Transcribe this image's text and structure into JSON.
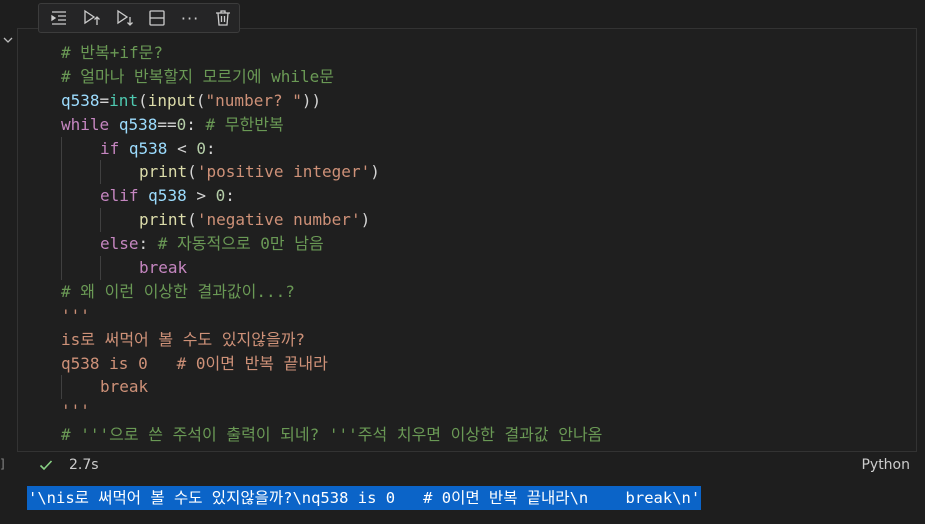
{
  "toolbar": {
    "buttons": [
      {
        "name": "run-by-line-icon"
      },
      {
        "name": "execute-above-icon"
      },
      {
        "name": "execute-below-icon"
      },
      {
        "name": "split-cell-icon"
      },
      {
        "name": "more-icon",
        "glyph": "···"
      },
      {
        "name": "delete-icon"
      }
    ]
  },
  "code": {
    "l1": "# 반복+if문?",
    "l2": "# 얼마나 반복할지 모르기에 while문",
    "l3": {
      "v": "q538",
      "eq": "=",
      "f1": "int",
      "p1": "(",
      "f2": "input",
      "p2": "(",
      "s": "\"number? \"",
      "p3": "))"
    },
    "l4": {
      "kw": "while",
      "sp": " ",
      "v": "q538",
      "op": "==",
      "n": "0",
      "colon": ":",
      "cm": " # 무한반복"
    },
    "l5": {
      "kw": "if",
      "sp": " ",
      "v": "q538",
      "op": " < ",
      "n": "0",
      "colon": ":"
    },
    "l6": {
      "f": "print",
      "p1": "(",
      "s": "'positive integer'",
      "p2": ")"
    },
    "l7": {
      "kw": "elif",
      "sp": " ",
      "v": "q538",
      "op": " > ",
      "n": "0",
      "colon": ":"
    },
    "l8": {
      "f": "print",
      "p1": "(",
      "s": "'negative number'",
      "p2": ")"
    },
    "l9": {
      "kw": "else",
      "colon": ":",
      "cm": " # 자동적으로 0만 남음"
    },
    "l10": "break",
    "l11": "# 왜 이런 이상한 결과값이...?",
    "l12": "'''",
    "l13": "is로 써먹어 볼 수도 있지않을까?",
    "l14": "q538 is 0   # 0이면 반복 끝내라",
    "l15": "break",
    "l16": "'''",
    "l17": "# '''으로 쓴 주석이 출력이 되네? '''주석 치우면 이상한 결과값 안나옴"
  },
  "status": {
    "time": "2.7s",
    "language": "Python"
  },
  "edge_label": "]",
  "output": "'\\nis로 써먹어 볼 수도 있지않을까?\\nq538 is 0   # 0이면 반복 끝내라\\n    break\\n'",
  "colors": {
    "comment": "#6a9955",
    "variable": "#9cdcfe",
    "function": "#dcdcaa",
    "class": "#4ec9b0",
    "keyword": "#c586c0",
    "string": "#ce9178",
    "number": "#b5cea8",
    "selection": "#0b64c8"
  }
}
